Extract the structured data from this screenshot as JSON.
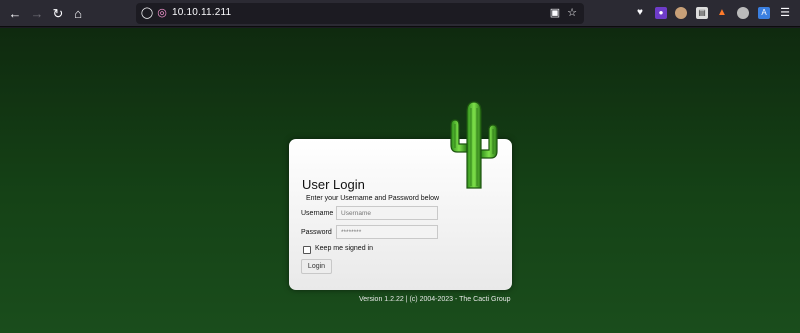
{
  "browser": {
    "url": "10.10.11.211",
    "nav_icons": [
      "back-icon",
      "forward-icon",
      "reload-icon",
      "home-icon"
    ],
    "toolbar_icons": [
      "pocket-icon",
      "extension-icon",
      "extension-icon",
      "extension-icon",
      "extension-icon",
      "extension-icon",
      "extension-icon",
      "menu-icon"
    ]
  },
  "login": {
    "title": "User Login",
    "subtitle": "Enter your Username and Password below",
    "username_label": "Username",
    "username_placeholder": "Username",
    "password_label": "Password",
    "password_placeholder": "********",
    "keep_signed_in_label": "Keep me signed in",
    "keep_signed_in_checked": false,
    "button_label": "Login"
  },
  "footer": {
    "version_text": "Version 1.2.22 | (c) 2004-2023 - The Cacti Group"
  },
  "colors": {
    "background_top": "#0f2a0f",
    "background_bottom": "#1a4d1c",
    "cactus": "#4caf2a",
    "browser_chrome": "#2b2a33"
  }
}
